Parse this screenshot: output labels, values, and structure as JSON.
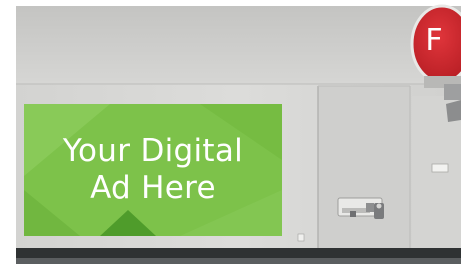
{
  "ad_panel": {
    "line1": "Your Digital",
    "line2": "Ad Here"
  },
  "sign": {
    "letter": "F"
  },
  "colors": {
    "wall": "#d8d8d6",
    "ad_green": "#7dc24a",
    "ad_green_dark": "#5ea733",
    "sign_red": "#c9252c",
    "baseboard": "#2f3233",
    "floor": "#5b5e60"
  }
}
